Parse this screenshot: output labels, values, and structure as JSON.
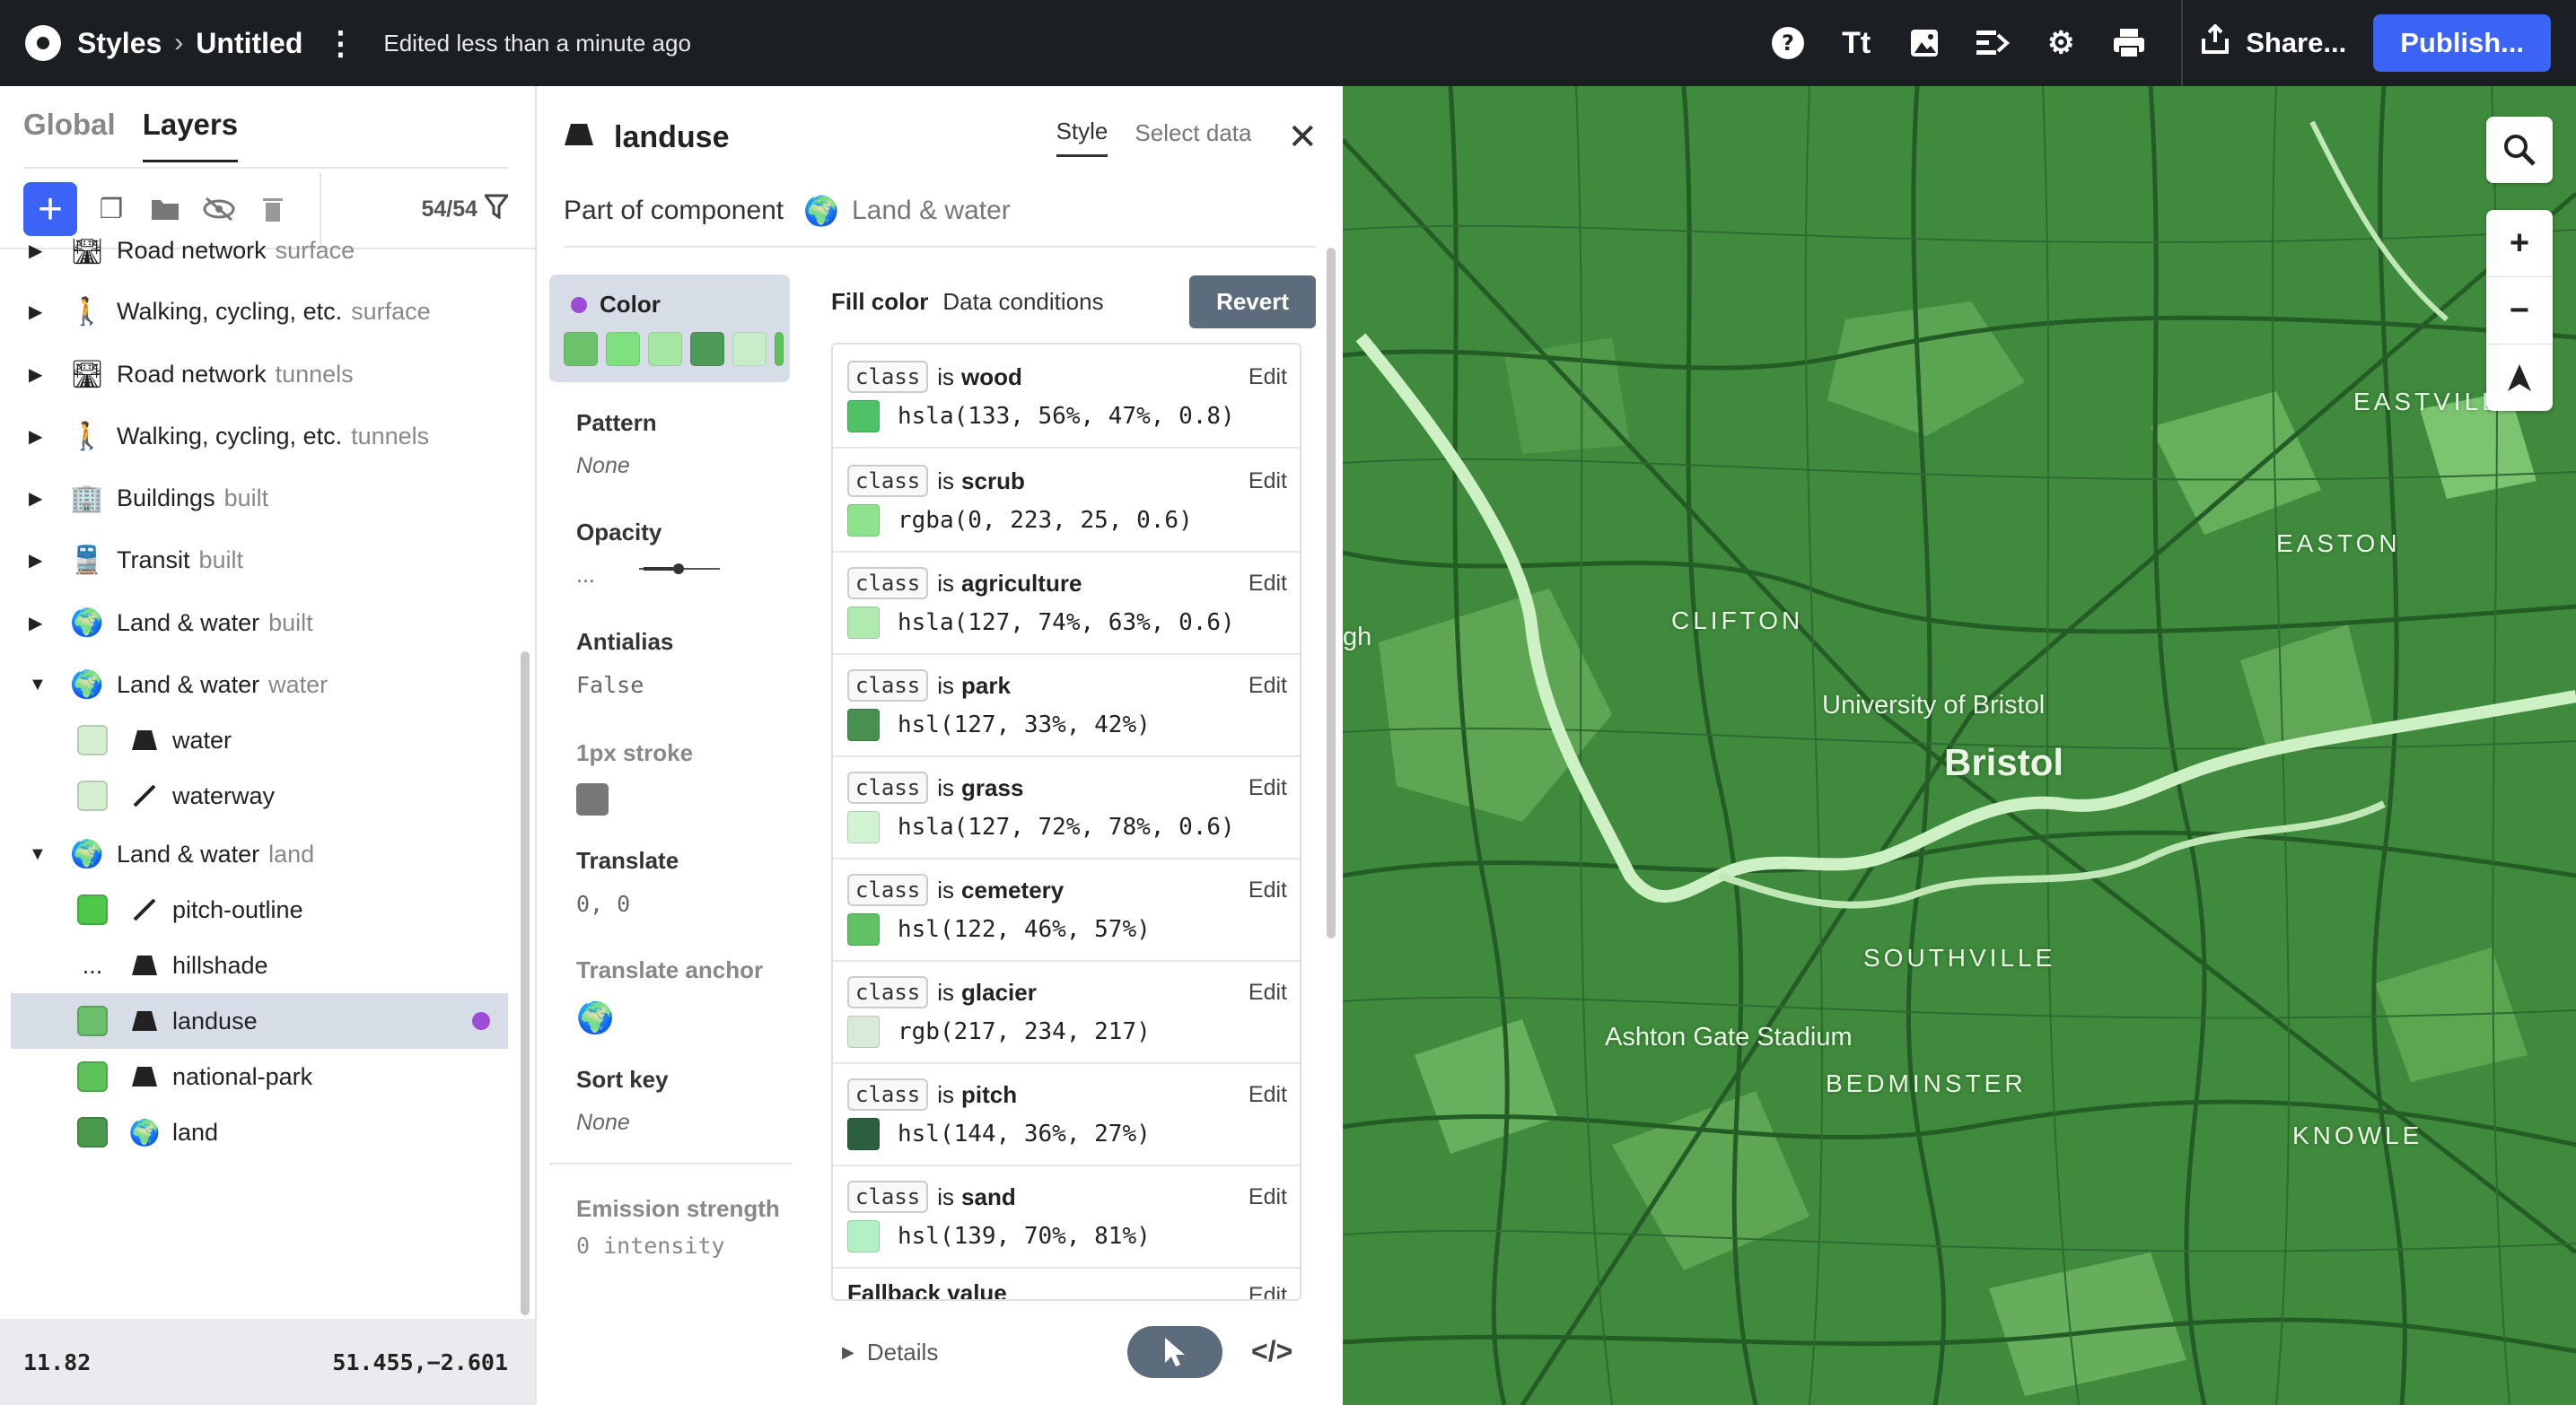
{
  "topbar": {
    "app_name": "Styles",
    "doc_title": "Untitled",
    "edited": "Edited less than a minute ago",
    "icons": [
      "help-icon",
      "typography-icon",
      "image-icon",
      "layers-import-icon",
      "settings-icon",
      "print-icon"
    ],
    "share_label": "Share...",
    "publish_label": "Publish..."
  },
  "left": {
    "tabs": [
      "Global",
      "Layers"
    ],
    "active_tab": "Layers",
    "layer_count": "54/54",
    "layers": [
      {
        "name": "Road network",
        "sub": "surface",
        "icon": "road-icon",
        "expanded": false
      },
      {
        "name": "Walking, cycling, etc.",
        "sub": "surface",
        "icon": "walking-icon",
        "expanded": false
      },
      {
        "name": "Road network",
        "sub": "tunnels",
        "icon": "road-icon",
        "expanded": false
      },
      {
        "name": "Walking, cycling, etc.",
        "sub": "tunnels",
        "icon": "walking-icon",
        "expanded": false
      },
      {
        "name": "Buildings",
        "sub": "built",
        "icon": "building-icon",
        "expanded": false
      },
      {
        "name": "Transit",
        "sub": "built",
        "icon": "transit-icon",
        "expanded": false
      },
      {
        "name": "Land & water",
        "sub": "built",
        "icon": "globe-icon",
        "expanded": false
      },
      {
        "name": "Land & water",
        "sub": "water",
        "icon": "globe-icon",
        "expanded": true
      },
      {
        "name": "Land & water",
        "sub": "land",
        "icon": "globe-icon",
        "expanded": true
      }
    ],
    "water_children": [
      {
        "name": "water",
        "type": "fill-icon",
        "swatch": "#d6efd0"
      },
      {
        "name": "waterway",
        "type": "line-icon",
        "swatch": "#d6efd0"
      }
    ],
    "land_children": [
      {
        "name": "pitch-outline",
        "type": "line-icon",
        "swatch": "#4fc74a"
      },
      {
        "name": "hillshade",
        "type": "fill-icon",
        "swatch": "..."
      },
      {
        "name": "landuse",
        "type": "fill-icon",
        "swatch": "#6cbf6a",
        "selected": true
      },
      {
        "name": "national-park",
        "type": "fill-icon",
        "swatch": "#5ec25a"
      },
      {
        "name": "land",
        "type": "globe-icon",
        "swatch": "#4a9a4d"
      }
    ],
    "zoom": "11.82",
    "coords": "51.455,−2.601"
  },
  "mid": {
    "layer_name": "landuse",
    "tabs": [
      "Style",
      "Select data"
    ],
    "active_tab": "Style",
    "component_label": "Part of component",
    "component_name": "Land & water",
    "props": {
      "color_label": "Color",
      "color_swatches": [
        "#6cc26a",
        "#7ee07e",
        "#a5e6a5",
        "#4f9a57",
        "#c8edc8",
        "#5ec25a"
      ],
      "pattern_label": "Pattern",
      "pattern_value": "None",
      "opacity_label": "Opacity",
      "opacity_value": "...",
      "antialias_label": "Antialias",
      "antialias_value": "False",
      "stroke_label": "1px stroke",
      "translate_label": "Translate",
      "translate_value": "0, 0",
      "translate_anchor_label": "Translate anchor",
      "sortkey_label": "Sort key",
      "sortkey_value": "None",
      "emission_label": "Emission strength",
      "emission_value": "0 intensity"
    },
    "fill_color_label": "Fill color",
    "data_conditions_label": "Data conditions",
    "revert_label": "Revert",
    "conditions": [
      {
        "key": "class",
        "op": "is",
        "value": "wood",
        "color": "hsla(133, 56%, 47%, 0.8)",
        "swatch": "#4fc267",
        "edit": "Edit"
      },
      {
        "key": "class",
        "op": "is",
        "value": "scrub",
        "color": "rgba(0, 223, 25, 0.6)",
        "swatch": "#8fe38f",
        "edit": "Edit"
      },
      {
        "key": "class",
        "op": "is",
        "value": "agriculture",
        "color": "hsla(127, 74%, 63%, 0.6)",
        "swatch": "#b0eab0",
        "edit": "Edit"
      },
      {
        "key": "class",
        "op": "is",
        "value": "park",
        "color": "hsl(127, 33%, 42%)",
        "swatch": "#479050",
        "edit": "Edit"
      },
      {
        "key": "class",
        "op": "is",
        "value": "grass",
        "color": "hsla(127, 72%, 78%, 0.6)",
        "swatch": "#d2f2d4",
        "edit": "Edit"
      },
      {
        "key": "class",
        "op": "is",
        "value": "cemetery",
        "color": "hsl(122, 46%, 57%)",
        "swatch": "#61c164",
        "edit": "Edit"
      },
      {
        "key": "class",
        "op": "is",
        "value": "glacier",
        "color": "rgb(217, 234, 217)",
        "swatch": "#d9ead9",
        "edit": "Edit"
      },
      {
        "key": "class",
        "op": "is",
        "value": "pitch",
        "color": "hsl(144, 36%, 27%)",
        "swatch": "#2c5e40",
        "edit": "Edit"
      },
      {
        "key": "class",
        "op": "is",
        "value": "sand",
        "color": "hsl(139, 70%, 81%)",
        "swatch": "#b3f0c6",
        "edit": "Edit"
      }
    ],
    "fallback_label": "Fallback value",
    "details_label": "Details"
  },
  "map": {
    "labels": [
      {
        "text": "EASTVILLE",
        "kind": "district"
      },
      {
        "text": "EASTON",
        "kind": "district"
      },
      {
        "text": "CLIFTON",
        "kind": "district"
      },
      {
        "text": "University of Bristol",
        "kind": "poi"
      },
      {
        "text": "Bristol",
        "kind": "city"
      },
      {
        "text": "SOUTHVILLE",
        "kind": "district"
      },
      {
        "text": "Ashton Gate Stadium",
        "kind": "poi"
      },
      {
        "text": "BEDMINSTER",
        "kind": "district"
      },
      {
        "text": "KNOWLE",
        "kind": "district"
      },
      {
        "text": "gh",
        "kind": "partial"
      }
    ],
    "colors": {
      "base": "#3f8a3c",
      "roads": "#1f5a22",
      "parks": "#67b35c",
      "water": "#d4f3cb"
    }
  }
}
